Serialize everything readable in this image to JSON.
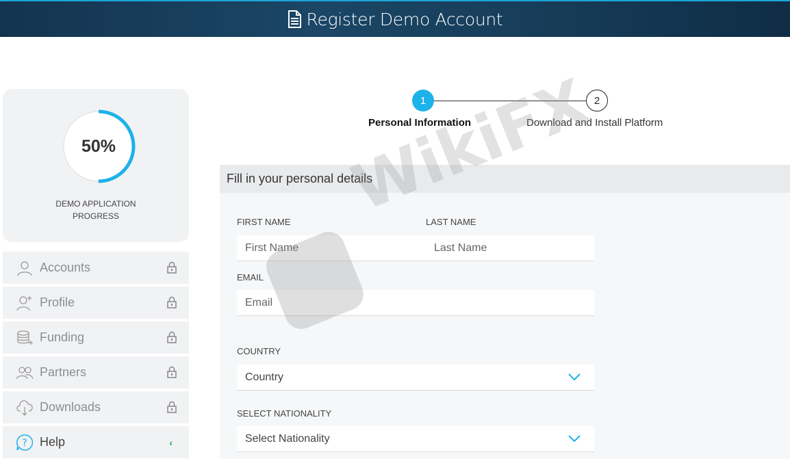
{
  "header": {
    "title": "Register Demo Account",
    "icon": "document-icon"
  },
  "progress": {
    "value": 0.5,
    "percent_label": "50%",
    "label": "DEMO APPLICATION PROGRESS",
    "ring_color": "#1cb2ea"
  },
  "menu": {
    "items": [
      {
        "label": "Accounts",
        "icon": "user-icon",
        "locked": true
      },
      {
        "label": "Profile",
        "icon": "user-plus-icon",
        "locked": true
      },
      {
        "label": "Funding",
        "icon": "coins-icon",
        "locked": true
      },
      {
        "label": "Partners",
        "icon": "users-icon",
        "locked": true
      },
      {
        "label": "Downloads",
        "icon": "cloud-download-icon",
        "locked": true
      }
    ],
    "help": {
      "label": "Help",
      "icon": "help-icon",
      "chevron": "‹"
    }
  },
  "stepper": {
    "steps": [
      {
        "number": "1",
        "label": "Personal Information",
        "active": true
      },
      {
        "number": "2",
        "label": "Download and Install Platform",
        "active": false
      }
    ],
    "active_color": "#1cb2ea"
  },
  "form": {
    "heading": "Fill in your personal details",
    "first_name": {
      "label": "FIRST NAME",
      "placeholder": "First Name",
      "value": ""
    },
    "last_name": {
      "label": "LAST NAME",
      "placeholder": "Last Name",
      "value": ""
    },
    "email": {
      "label": "EMAIL",
      "placeholder": "Email",
      "value": ""
    },
    "country": {
      "label": "COUNTRY",
      "selected": "Country"
    },
    "nationality": {
      "label": "SELECT NATIONALITY",
      "selected": "Select Nationality"
    },
    "dropdown_color": "#1cb2ea"
  },
  "watermark": {
    "text": "WikiFX"
  }
}
